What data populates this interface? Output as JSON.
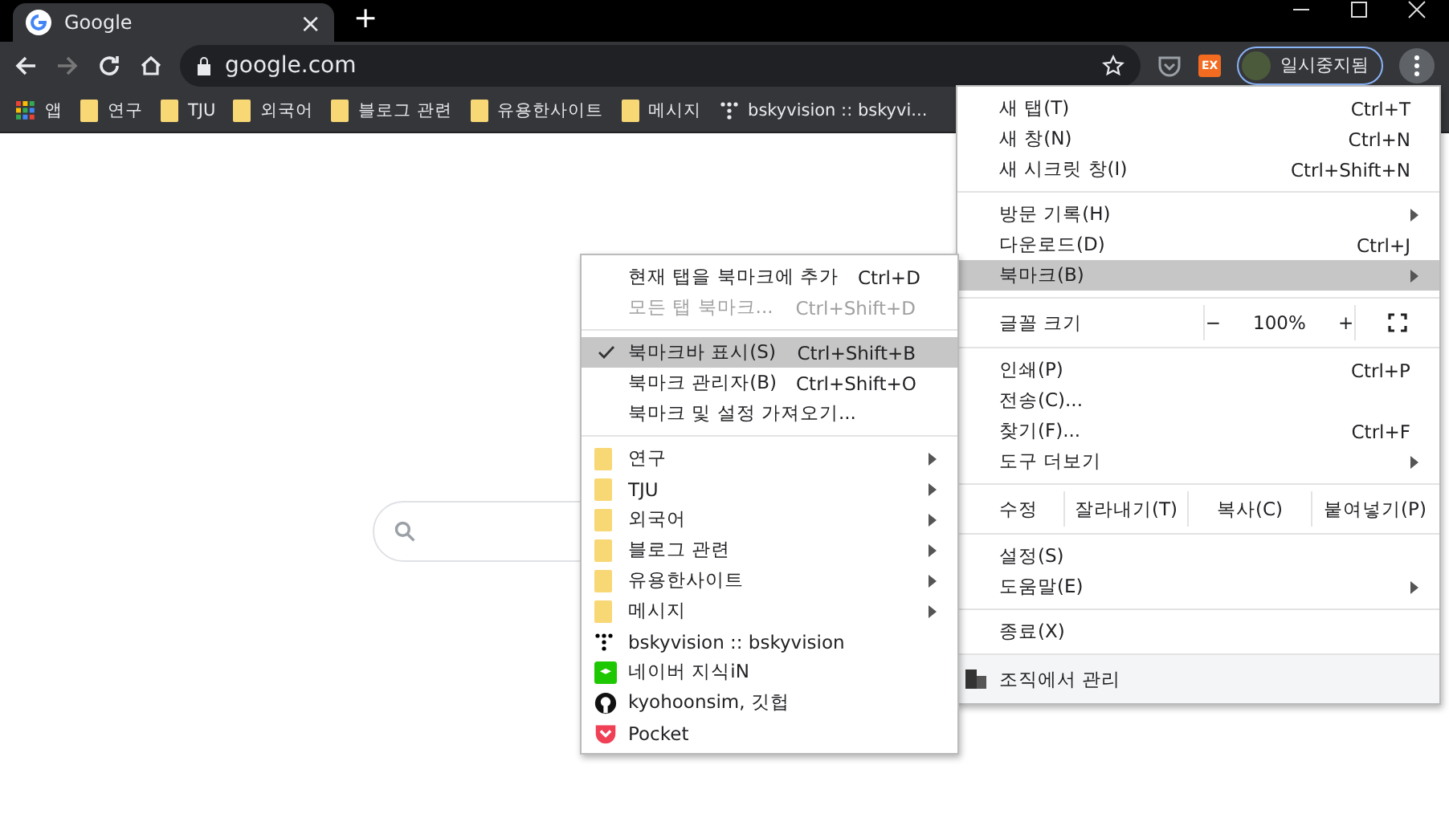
{
  "tab": {
    "title": "Google",
    "close": "×"
  },
  "new_tab": "+",
  "toolbar": {
    "back_enabled": true,
    "forward_enabled": false,
    "url": "google.com",
    "profile": "일시중지됨",
    "extension_badge": "EX"
  },
  "bookmarks_bar": [
    {
      "kind": "apps",
      "label": "앱"
    },
    {
      "kind": "folder",
      "label": "연구"
    },
    {
      "kind": "folder",
      "label": "TJU"
    },
    {
      "kind": "folder",
      "label": "외국어"
    },
    {
      "kind": "folder",
      "label": "블로그 관련"
    },
    {
      "kind": "folder",
      "label": "유용한사이트"
    },
    {
      "kind": "folder",
      "label": "메시지"
    },
    {
      "kind": "site-dots",
      "label": "bskyvision :: bskyvi..."
    }
  ],
  "main_menu": {
    "sections": [
      {
        "kind": "items",
        "items": [
          {
            "label": "새 탭(T)",
            "shortcut": "Ctrl+T",
            "submenu": false,
            "selected": false
          },
          {
            "label": "새 창(N)",
            "shortcut": "Ctrl+N",
            "submenu": false,
            "selected": false
          },
          {
            "label": "새 시크릿 창(I)",
            "shortcut": "Ctrl+Shift+N",
            "submenu": false,
            "selected": false
          }
        ]
      },
      {
        "kind": "items",
        "items": [
          {
            "label": "방문 기록(H)",
            "submenu": true,
            "selected": false
          },
          {
            "label": "다운로드(D)",
            "shortcut": "Ctrl+J",
            "submenu": false,
            "selected": false
          },
          {
            "label": "북마크(B)",
            "submenu": true,
            "selected": true
          }
        ]
      },
      {
        "kind": "zoom",
        "label": "글꼴 크기",
        "minus": "−",
        "value": "100%",
        "plus": "+"
      },
      {
        "kind": "items",
        "items": [
          {
            "label": "인쇄(P)",
            "shortcut": "Ctrl+P",
            "submenu": false,
            "selected": false
          },
          {
            "label": "전송(C)...",
            "submenu": false,
            "selected": false
          },
          {
            "label": "찾기(F)...",
            "shortcut": "Ctrl+F",
            "submenu": false,
            "selected": false
          },
          {
            "label": "도구 더보기",
            "submenu": true,
            "selected": false
          }
        ]
      },
      {
        "kind": "edit",
        "label": "수정",
        "buttons": [
          "잘라내기(T)",
          "복사(C)",
          "붙여넣기(P)"
        ]
      },
      {
        "kind": "items",
        "items": [
          {
            "label": "설정(S)",
            "submenu": false,
            "selected": false
          },
          {
            "label": "도움말(E)",
            "submenu": true,
            "selected": false
          }
        ]
      },
      {
        "kind": "items",
        "items": [
          {
            "label": "종료(X)",
            "submenu": false,
            "selected": false
          }
        ]
      },
      {
        "kind": "managed",
        "label": "조직에서 관리"
      }
    ]
  },
  "bookmark_menu": {
    "sections": [
      [
        {
          "kind": "action",
          "label": "현재 탭을 북마크에 추가",
          "shortcut": "Ctrl+D",
          "disabled": false,
          "checked": false,
          "selected": false
        },
        {
          "kind": "action",
          "label": "모든 탭 북마크...",
          "shortcut": "Ctrl+Shift+D",
          "disabled": true,
          "checked": false,
          "selected": false
        }
      ],
      [
        {
          "kind": "action",
          "label": "북마크바 표시(S)",
          "shortcut": "Ctrl+Shift+B",
          "disabled": false,
          "checked": true,
          "selected": true
        },
        {
          "kind": "action",
          "label": "북마크 관리자(B)",
          "shortcut": "Ctrl+Shift+O",
          "disabled": false,
          "checked": false,
          "selected": false
        },
        {
          "kind": "action",
          "label": "북마크 및 설정 가져오기...",
          "disabled": false,
          "checked": false,
          "selected": false
        }
      ],
      [
        {
          "kind": "folder",
          "label": "연구",
          "disabled": false,
          "checked": false,
          "selected": false
        },
        {
          "kind": "folder",
          "label": "TJU",
          "disabled": false,
          "checked": false,
          "selected": false
        },
        {
          "kind": "folder",
          "label": "외국어",
          "disabled": false,
          "checked": false,
          "selected": false
        },
        {
          "kind": "folder",
          "label": "블로그 관련",
          "disabled": false,
          "checked": false,
          "selected": false
        },
        {
          "kind": "folder",
          "label": "유용한사이트",
          "disabled": false,
          "checked": false,
          "selected": false
        },
        {
          "kind": "folder",
          "label": "메시지",
          "disabled": false,
          "checked": false,
          "selected": false
        },
        {
          "kind": "site-dots",
          "label": "bskyvision :: bskyvision",
          "disabled": false,
          "checked": false,
          "selected": false
        },
        {
          "kind": "site-naver",
          "label": "네이버 지식iN",
          "disabled": false,
          "checked": false,
          "selected": false
        },
        {
          "kind": "site-github",
          "label": "kyohoonsim, 깃헙",
          "disabled": false,
          "checked": false,
          "selected": false
        },
        {
          "kind": "site-pocket",
          "label": "Pocket",
          "disabled": false,
          "checked": false,
          "selected": false
        }
      ]
    ]
  }
}
